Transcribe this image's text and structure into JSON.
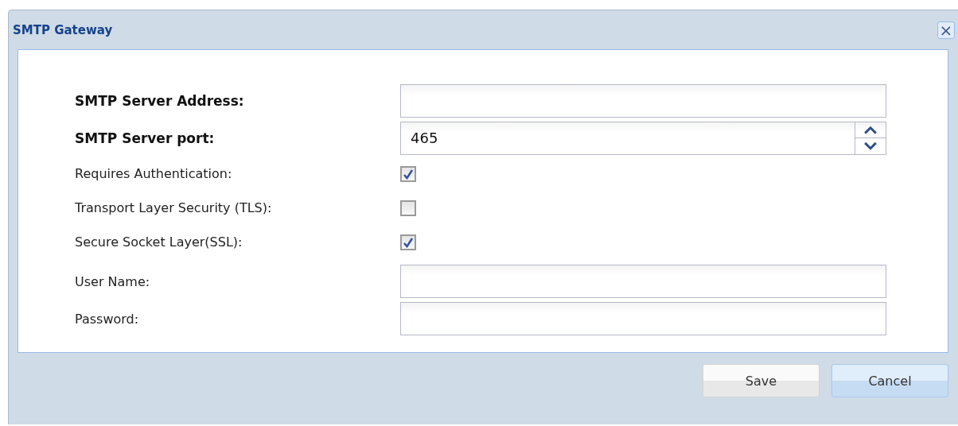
{
  "window": {
    "title": "SMTP Gateway",
    "close": "×"
  },
  "fields": [
    {
      "kind": "text",
      "label": "SMTP Server Address:",
      "bold": true
    },
    {
      "kind": "spinner",
      "label": "SMTP Server port:",
      "bold": true,
      "value": "465"
    },
    {
      "kind": "checkbox",
      "label": "Requires Authentication:",
      "bold": false,
      "checked": true
    },
    {
      "kind": "checkbox",
      "label": "Transport Layer Security (TLS):",
      "bold": false,
      "checked": false
    },
    {
      "kind": "checkbox",
      "label": "Secure Socket Layer(SSL):",
      "bold": false,
      "checked": true
    },
    {
      "kind": "text",
      "label": "User Name:",
      "bold": false
    },
    {
      "kind": "password",
      "label": "Password:",
      "bold": false
    }
  ],
  "buttons": [
    {
      "label": "Save",
      "default": false
    },
    {
      "label": "Cancel",
      "default": true
    }
  ]
}
